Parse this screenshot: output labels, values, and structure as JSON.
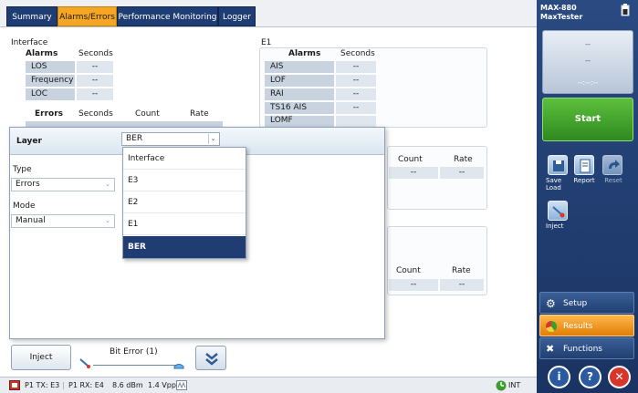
{
  "tabs": [
    "Summary",
    "Alarms/Errors",
    "Performance Monitoring",
    "Logger"
  ],
  "interface": {
    "title": "Interface",
    "alarms_header": "Alarms",
    "seconds_header": "Seconds",
    "alarms": [
      {
        "label": "LOS",
        "value": "--"
      },
      {
        "label": "Frequency",
        "value": "--"
      },
      {
        "label": "LOC",
        "value": "--"
      }
    ],
    "errors_header": "Errors",
    "errors_seconds_header": "Seconds",
    "count_header": "Count",
    "rate_header": "Rate"
  },
  "e1": {
    "title": "E1",
    "alarms_header": "Alarms",
    "seconds_header": "Seconds",
    "alarms": [
      {
        "label": "AIS",
        "value": "--"
      },
      {
        "label": "LOF",
        "value": "--"
      },
      {
        "label": "RAI",
        "value": "--"
      },
      {
        "label": "TS16 AIS",
        "value": "--"
      }
    ],
    "partial_row": "LOMF",
    "count_header": "Count",
    "rate_header": "Rate",
    "count_value": "--",
    "rate_value": "--"
  },
  "lower_panel": {
    "count_header": "Count",
    "rate_header": "Rate",
    "count_value": "--",
    "rate_value": "--"
  },
  "dialog": {
    "layer_label": "Layer",
    "layer_value": "BER",
    "type_label": "Type",
    "type_value": "Errors",
    "mode_label": "Mode",
    "mode_value": "Manual",
    "options": [
      "Interface",
      "E3",
      "E2",
      "E1",
      "BER"
    ]
  },
  "controls": {
    "inject_label": "Inject",
    "bit_error_label": "Bit Error (1)"
  },
  "status": {
    "tx": "P1 TX: E3",
    "rx": "P1 RX: E4",
    "power": "8.6 dBm",
    "vpp": "1.4 Vpp",
    "clock": "INT"
  },
  "sidebar": {
    "device": "MAX-880",
    "model": "MaxTester",
    "display_top": "--",
    "display_mid": "--",
    "timer": "--:--:--",
    "start_label": "Start",
    "tools": [
      {
        "label": "Save Load",
        "icon": "save-load-icon"
      },
      {
        "label": "Report",
        "icon": "report-icon"
      },
      {
        "label": "Reset",
        "icon": "reset-icon"
      }
    ],
    "inject_tool": "Inject",
    "nav": [
      {
        "label": "Setup",
        "icon": "gear-icon"
      },
      {
        "label": "Results",
        "icon": "results-icon"
      },
      {
        "label": "Functions",
        "icon": "functions-icon"
      }
    ],
    "colors": {
      "start": "#3f9b2e",
      "results_active": "#f5a623",
      "stop": "#d9362b"
    }
  }
}
